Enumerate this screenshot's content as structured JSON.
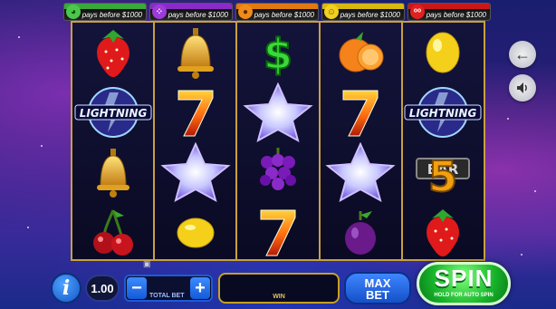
{
  "jackpots": [
    {
      "label": "pays before $1000",
      "icon": "melon-icon",
      "color": "#4bc84b"
    },
    {
      "label": "pays before $1000",
      "icon": "grapes-icon",
      "color": "#9b3bd8"
    },
    {
      "label": "pays before $1000",
      "icon": "orange-icon",
      "color": "#f08a1a"
    },
    {
      "label": "pays before $1000",
      "icon": "lemon-icon",
      "color": "#f0d020"
    },
    {
      "label": "pays before $1000",
      "icon": "cherry-icon",
      "color": "#e02020"
    }
  ],
  "reels": [
    [
      "strawberry-icon",
      "lightning-icon",
      "bell-icon",
      "cherry-icon"
    ],
    [
      "bell-icon",
      "seven-icon",
      "star-icon",
      "lemon-icon"
    ],
    [
      "dollar-icon",
      "star-icon",
      "grapes-icon",
      "seven-icon"
    ],
    [
      "orange-icon",
      "seven-icon",
      "star-icon",
      "plum-icon"
    ],
    [
      "lemon-icon",
      "lightning-icon",
      "bar-icon",
      "strawberry-icon"
    ]
  ],
  "symbols": {
    "lightning_text": "LIGHTNING",
    "bar_text": "BAR",
    "bar_number": "5",
    "seven_text": "7",
    "dollar_text": "$"
  },
  "side": {
    "back_icon": "arrow-left-icon",
    "sound_icon": "speaker-icon"
  },
  "bottom": {
    "info_label": "i",
    "coin_value": "1.00",
    "minus_label": "−",
    "plus_label": "+",
    "total_bet_label": "TOTAL BET",
    "total_bet_value": "",
    "win_label": "WIN",
    "win_value": "",
    "max_bet_line1": "MAX",
    "max_bet_line2": "BET",
    "spin_label": "SPIN",
    "spin_sub": "HOLD FOR AUTO SPIN"
  },
  "colors": {
    "frame": "#c8a040",
    "accent_blue": "#1b5bd8",
    "spin_green": "#17b42a"
  }
}
